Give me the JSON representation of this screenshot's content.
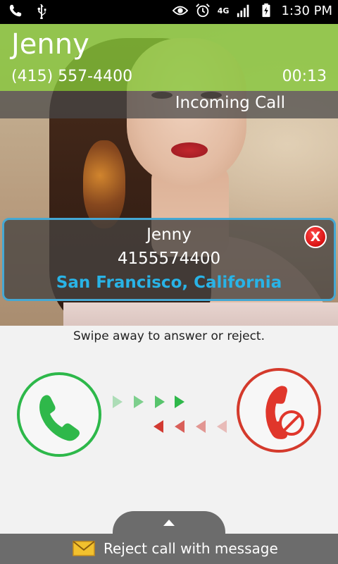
{
  "status_bar": {
    "time": "1:30 PM",
    "network": "4G",
    "icons": [
      "phone-icon",
      "usb-icon",
      "eye-icon",
      "alarm-icon",
      "signal-icon",
      "battery-icon"
    ]
  },
  "caller": {
    "name": "Jenny",
    "number_formatted": "(415) 557-4400",
    "timer": "00:13",
    "status": "Incoming Call"
  },
  "info_card": {
    "name": "Jenny",
    "number": "4155574400",
    "location": "San Francisco, California",
    "close_icon": "close-icon",
    "close_label": "X"
  },
  "controls": {
    "hint": "Swipe away to answer or reject.",
    "answer_icon": "answer-phone-icon",
    "reject_icon": "reject-phone-icon",
    "colors": {
      "answer": "#2db84a",
      "reject": "#d43a2c"
    }
  },
  "drawer": {
    "label": "Reject call with message",
    "icon": "envelope-icon"
  },
  "theme": {
    "header_green": "#84c838",
    "card_border": "#45a8d3",
    "location_blue": "#29b3e6"
  }
}
